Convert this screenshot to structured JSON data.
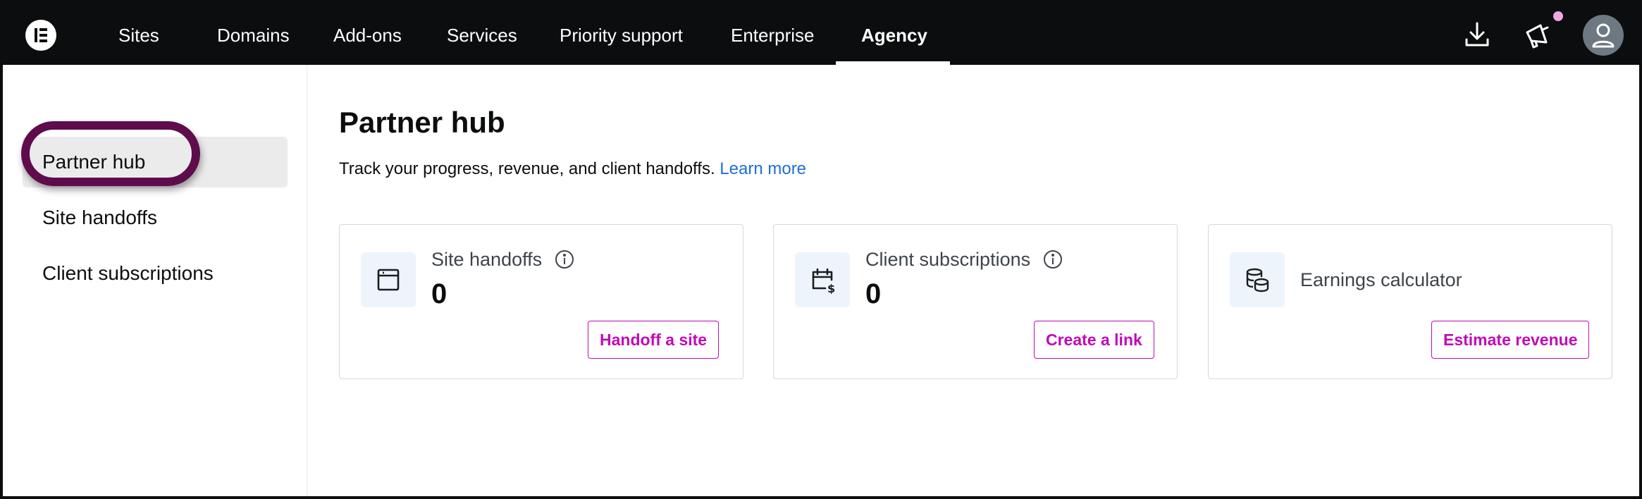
{
  "topbar": {
    "nav": [
      "Sites",
      "Domains",
      "Add-ons",
      "Services",
      "Priority support",
      "Enterprise",
      "Agency"
    ],
    "active_nav": "Agency",
    "icons": [
      "elementor-logo-icon",
      "download-icon",
      "megaphone-icon",
      "user-avatar-icon"
    ],
    "notification_dot_color": "#f0a8e5"
  },
  "sidebar": {
    "items": [
      "Partner hub",
      "Site handoffs",
      "Client subscriptions"
    ],
    "active_item": "Partner hub",
    "highlighted_item": "Site handoffs",
    "highlight_color": "#5e0c4c"
  },
  "main": {
    "title": "Partner hub",
    "subtitle": "Track your progress, revenue, and client handoffs.",
    "learn_more": "Learn more",
    "cards": [
      {
        "label": "Site handoffs",
        "value": "0",
        "button": "Handoff a site",
        "icon": "browser-window-icon"
      },
      {
        "label": "Client subscriptions",
        "value": "0",
        "button": "Create a link",
        "icon": "calendar-dollar-icon"
      },
      {
        "label": "Earnings calculator",
        "button": "Estimate revenue",
        "icon": "coins-stack-icon"
      }
    ]
  },
  "colors": {
    "accent": "#c00bb5",
    "link": "#1f6fd6",
    "topbar_bg": "#0c0d0e"
  }
}
